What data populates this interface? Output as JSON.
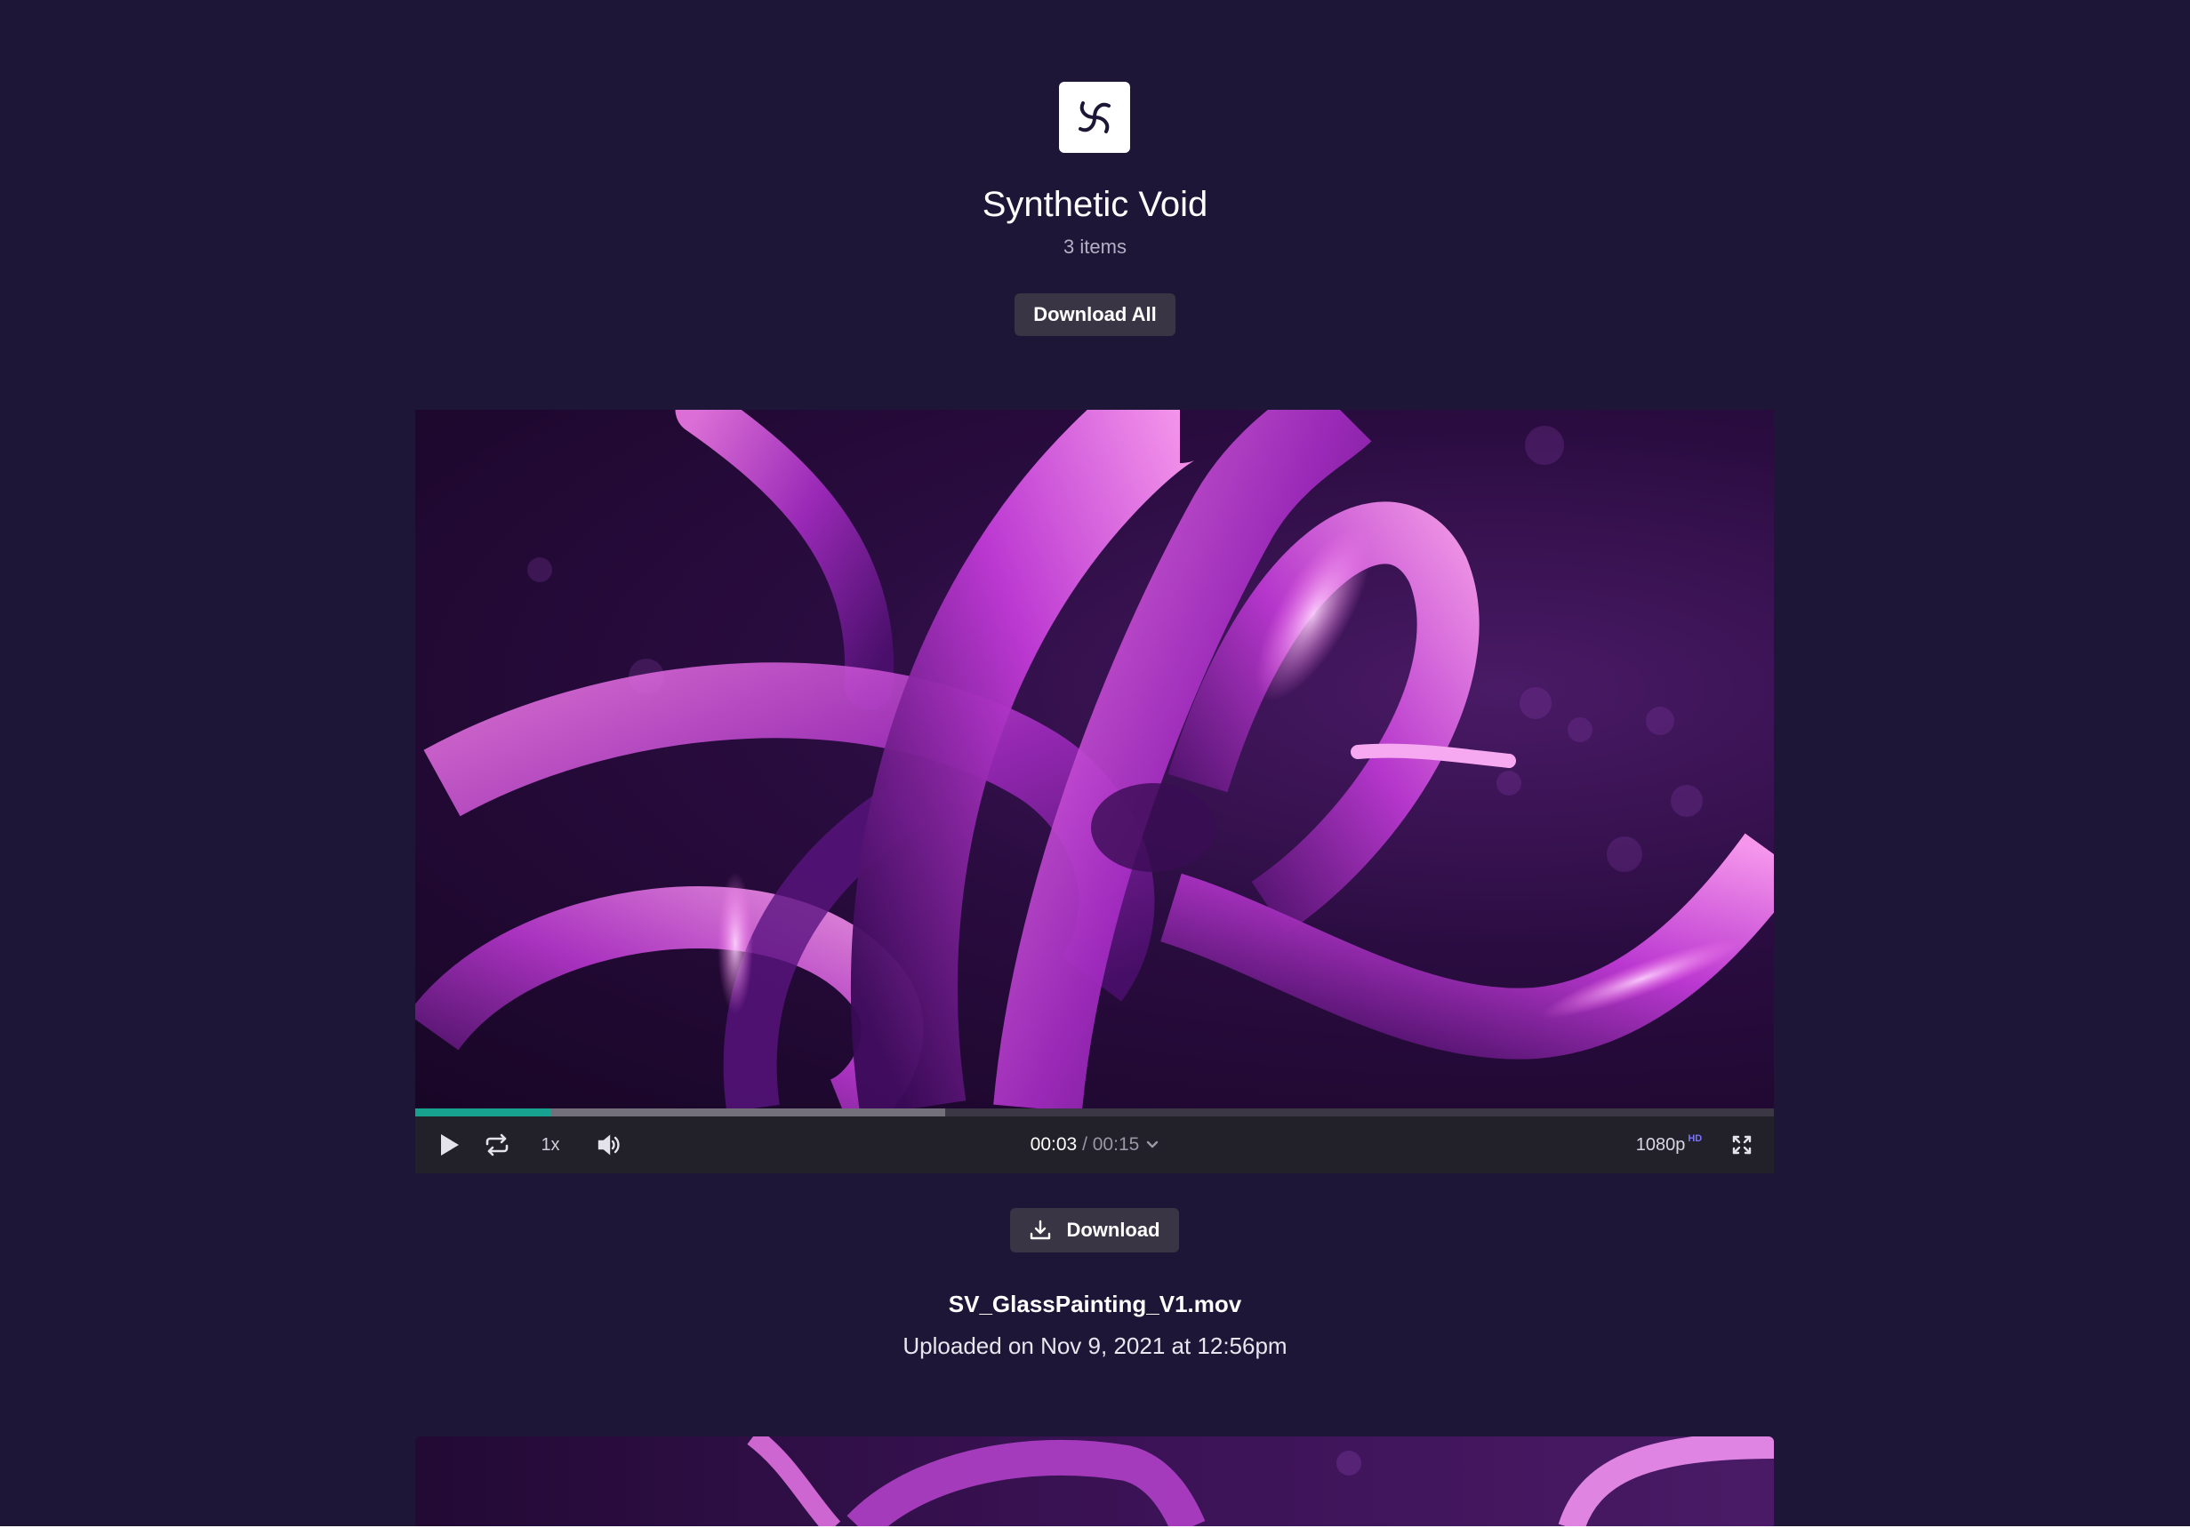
{
  "project": {
    "title": "Synthetic Void",
    "item_count": "3 items",
    "download_all_label": "Download All"
  },
  "player": {
    "current_time": "00:03",
    "separator": " / ",
    "duration": "00:15",
    "speed": "1x",
    "quality": "1080p",
    "quality_badge": "HD",
    "played_fraction": 0.1,
    "buffered_fraction": 0.39
  },
  "asset": {
    "download_label": "Download",
    "filename": "SV_GlassPainting_V1.mov",
    "uploaded": "Uploaded on Nov 9, 2021 at 12:56pm"
  },
  "icons": {
    "logo": "spiral-logo-icon",
    "play": "play-icon",
    "loop": "loop-icon",
    "volume": "volume-icon",
    "chevron": "chevron-down-icon",
    "fullscreen": "fullscreen-icon",
    "download": "download-icon"
  },
  "colors": {
    "background": "#1d1636",
    "progress_played": "#17a28f",
    "hd_badge": "#7b72ff",
    "button_bg": "#3a3544"
  }
}
